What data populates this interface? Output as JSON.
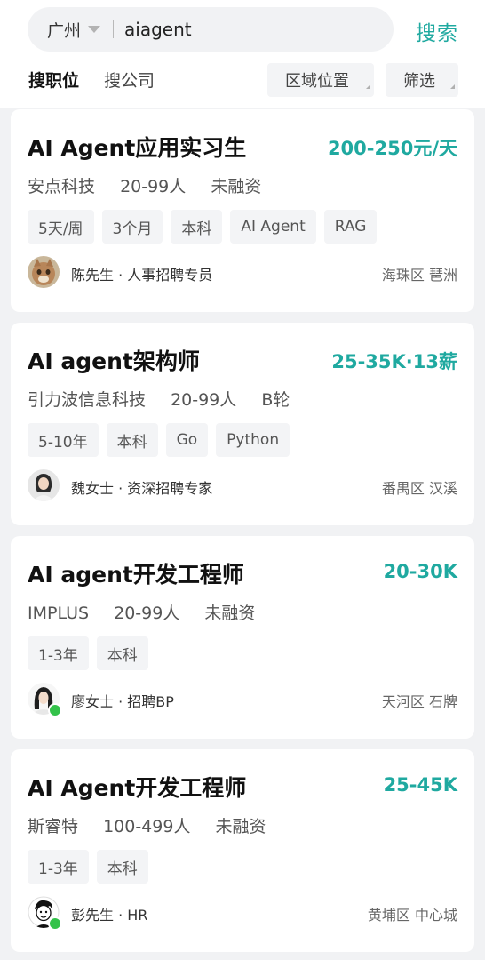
{
  "search": {
    "city": "广州",
    "query": "aiagent",
    "button_label": "搜索"
  },
  "tabs": [
    {
      "label": "搜职位",
      "active": true
    },
    {
      "label": "搜公司",
      "active": false
    }
  ],
  "filters": {
    "location_label": "区域位置",
    "filter_label": "筛选"
  },
  "jobs": [
    {
      "title": "AI Agent应用实习生",
      "salary": "200-250元/天",
      "company": "安点科技",
      "size": "20-99人",
      "funding": "未融资",
      "tags": [
        "5天/周",
        "3个月",
        "本科",
        "AI Agent",
        "RAG"
      ],
      "recruiter": "陈先生 · 人事招聘专员",
      "location": "海珠区 琶洲",
      "online": false
    },
    {
      "title": "AI agent架构师",
      "salary": "25-35K·13薪",
      "company": "引力波信息科技",
      "size": "20-99人",
      "funding": "B轮",
      "tags": [
        "5-10年",
        "本科",
        "Go",
        "Python"
      ],
      "recruiter": "魏女士 · 资深招聘专家",
      "location": "番禺区 汉溪",
      "online": false
    },
    {
      "title": "AI agent开发工程师",
      "salary": "20-30K",
      "company": "IMPLUS",
      "size": "20-99人",
      "funding": "未融资",
      "tags": [
        "1-3年",
        "本科"
      ],
      "recruiter": "廖女士 · 招聘BP",
      "location": "天河区 石牌",
      "online": true
    },
    {
      "title": "AI Agent开发工程师",
      "salary": "25-45K",
      "company": "斯睿特",
      "size": "100-499人",
      "funding": "未融资",
      "tags": [
        "1-3年",
        "本科"
      ],
      "recruiter": "彭先生 · HR",
      "location": "黄埔区 中心城",
      "online": true
    }
  ],
  "colors": {
    "accent": "#1fa9a0",
    "online": "#33c24a",
    "page_bg": "#f1f2f4"
  }
}
